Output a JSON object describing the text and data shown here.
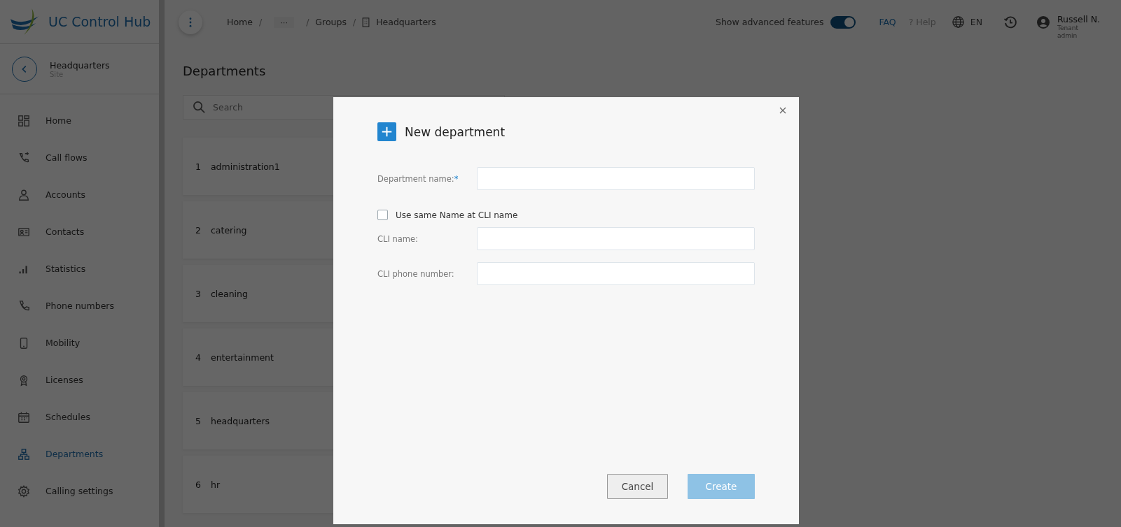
{
  "app": {
    "name": "UC Control Hub"
  },
  "breadcrumb": [
    {
      "kind": "link",
      "label": "Home"
    },
    {
      "kind": "ellipsis",
      "separator": "/",
      "label": "···"
    },
    {
      "kind": "link",
      "separator": "/",
      "label": "Groups"
    },
    {
      "kind": "building",
      "separator": "/",
      "label": "Headquarters"
    }
  ],
  "header": {
    "advanced_toggle": {
      "label": "Show advanced features",
      "on": true
    },
    "faq": "FAQ",
    "help": "? Help",
    "language": "EN",
    "user": {
      "name": "Russell N.",
      "role": [
        "Tenant",
        "admin"
      ]
    }
  },
  "site": {
    "name": "Headquarters",
    "type": "Site"
  },
  "sidebar": {
    "items": [
      {
        "label": "Home",
        "selected": false
      },
      {
        "label": "Call flows",
        "selected": false
      },
      {
        "label": "Accounts",
        "selected": false
      },
      {
        "label": "Contacts",
        "selected": false
      },
      {
        "label": "Statistics",
        "selected": false
      },
      {
        "label": "Phone numbers",
        "selected": false
      },
      {
        "label": "Mobility",
        "selected": false
      },
      {
        "label": "Licenses",
        "selected": false
      },
      {
        "label": "Schedules",
        "selected": false
      },
      {
        "label": "Departments",
        "selected": true
      },
      {
        "label": "Calling settings",
        "selected": false
      }
    ]
  },
  "page": {
    "title": "Departments",
    "search": {
      "placeholder": "Search"
    },
    "departments": [
      {
        "index": "1",
        "name": "administration1"
      },
      {
        "index": "2",
        "name": "catering"
      },
      {
        "index": "3",
        "name": "cleaning"
      },
      {
        "index": "4",
        "name": "entertainment"
      },
      {
        "index": "5",
        "name": "headquarters"
      },
      {
        "index": "6",
        "name": "hr"
      }
    ]
  },
  "dialog": {
    "title": "New department",
    "fields": [
      {
        "kind": "input",
        "label": "Department name:",
        "required_mark": "*"
      },
      {
        "kind": "checkbox",
        "label": "Use same Name at CLI name",
        "checked": false
      },
      {
        "kind": "input",
        "label": "CLI name:"
      },
      {
        "kind": "input",
        "label": "CLI phone number:"
      }
    ],
    "buttons": [
      {
        "kind": "secondary",
        "label": "Cancel",
        "disabled": false
      },
      {
        "kind": "primary",
        "label": "Create",
        "disabled": true
      }
    ]
  }
}
